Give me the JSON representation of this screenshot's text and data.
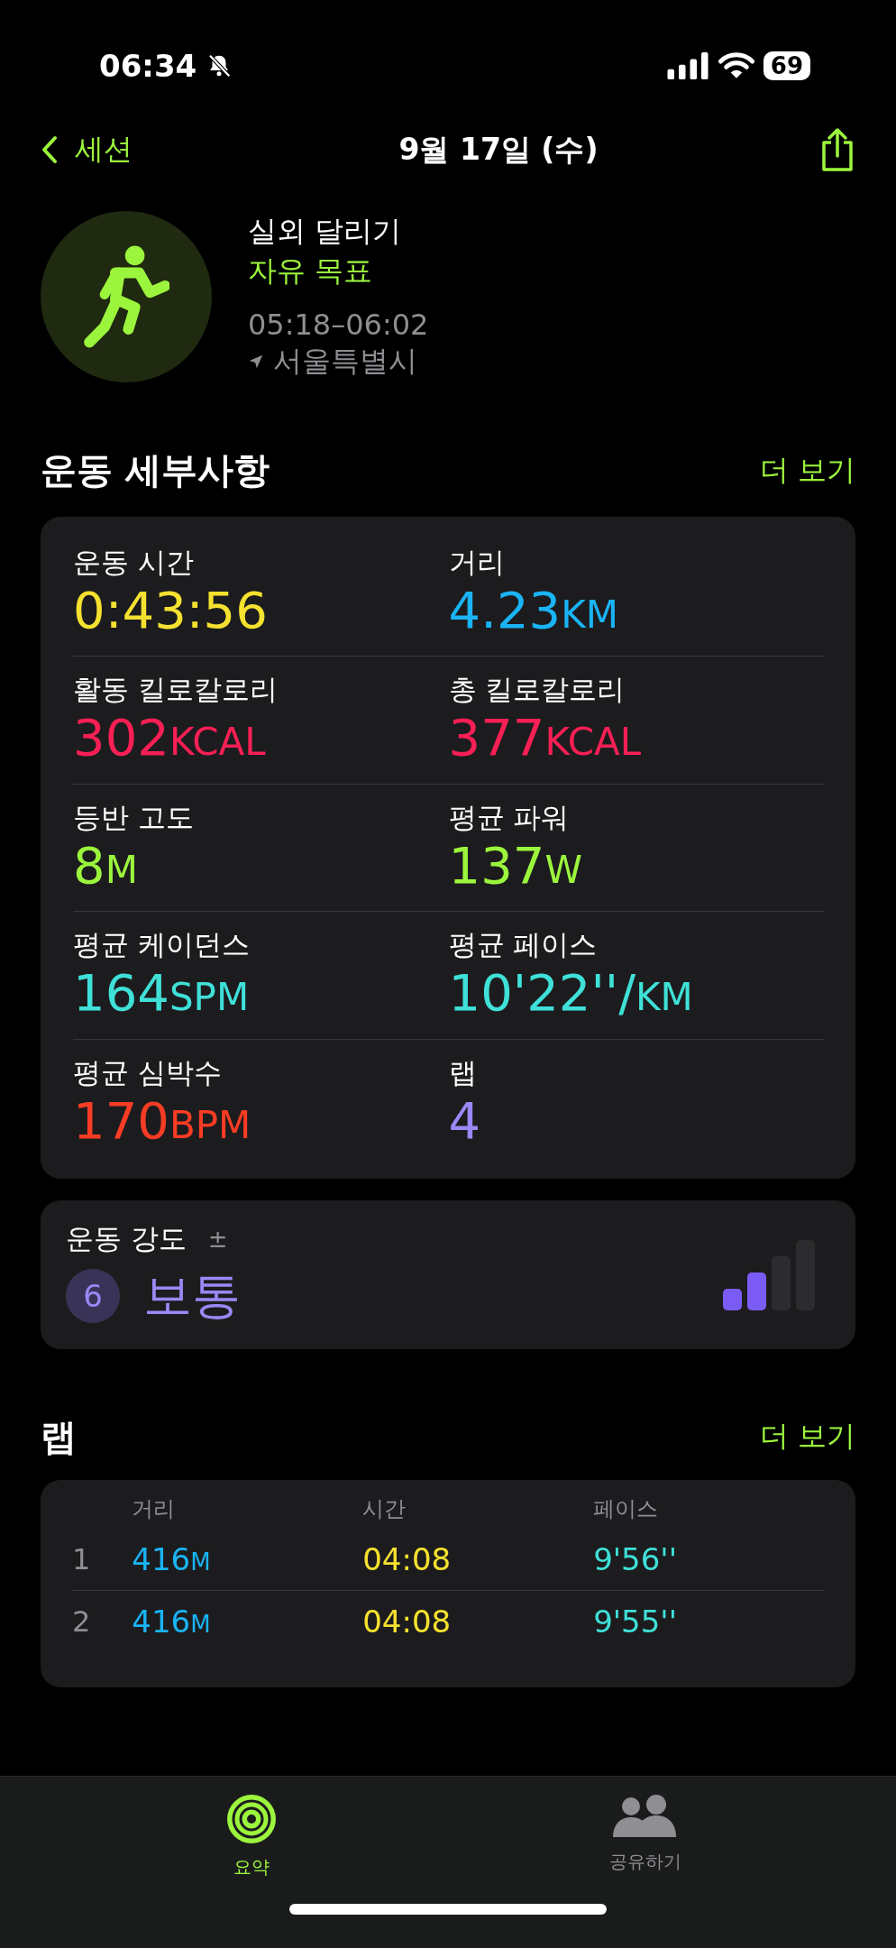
{
  "status_bar": {
    "time": "06:34",
    "battery": "69"
  },
  "nav": {
    "back": "세션",
    "title": "9월 17일 (수)"
  },
  "workout": {
    "name": "실외 달리기",
    "goal": "자유 목표",
    "time_range": "05:18–06:02",
    "location": "서울특별시"
  },
  "details": {
    "title": "운동 세부사항",
    "more": "더 보기",
    "metrics": [
      {
        "label": "운동 시간",
        "value": "0:43:56",
        "color": "#f5e12f"
      },
      {
        "label": "거리",
        "value": "4.23",
        "unit": "KM",
        "color": "#1ab4f5"
      },
      {
        "label": "활동 킬로칼로리",
        "value": "302",
        "unit": "KCAL",
        "color": "#fa1f55"
      },
      {
        "label": "총 킬로칼로리",
        "value": "377",
        "unit": "KCAL",
        "color": "#fa1f55"
      },
      {
        "label": "등반 고도",
        "value": "8",
        "unit": "M",
        "color": "#9cf53d"
      },
      {
        "label": "평균 파워",
        "value": "137",
        "unit": "W",
        "color": "#9cf53d"
      },
      {
        "label": "평균 케이던스",
        "value": "164",
        "unit": "SPM",
        "color": "#3fe0d8"
      },
      {
        "label": "평균 페이스",
        "value": "10'22''/",
        "unit": "KM",
        "color": "#3fe0d8"
      },
      {
        "label": "평균 심박수",
        "value": "170",
        "unit": "BPM",
        "color": "#fa3c24"
      },
      {
        "label": "랩",
        "value": "4",
        "color": "#9b87f5"
      }
    ]
  },
  "intensity": {
    "label": "운동 강도",
    "adjust": "±",
    "score": "6",
    "value": "보통",
    "level": 0.5
  },
  "laps": {
    "title": "랩",
    "more": "더 보기",
    "columns": [
      "거리",
      "시간",
      "페이스"
    ],
    "rows": [
      {
        "index": "1",
        "distance": "416",
        "distance_unit": "M",
        "time": "04:08",
        "pace": "9'56''"
      },
      {
        "index": "2",
        "distance": "416",
        "distance_unit": "M",
        "time": "04:08",
        "pace": "9'55''"
      }
    ]
  },
  "tabs": [
    {
      "label": "요약",
      "kind": "rings",
      "selected": true
    },
    {
      "label": "공유하기",
      "kind": "people",
      "selected": false
    }
  ]
}
